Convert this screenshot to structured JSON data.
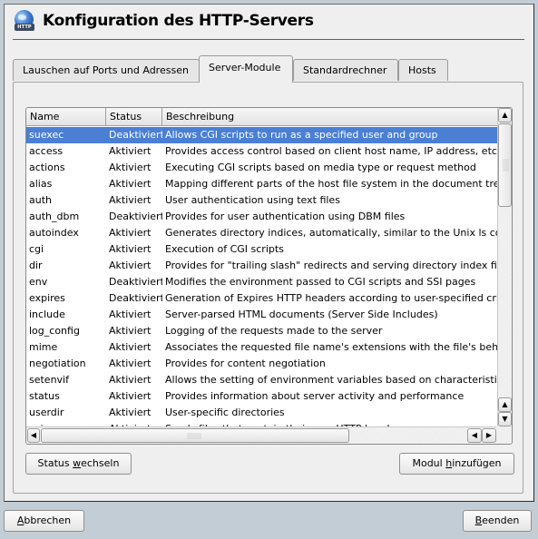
{
  "header": {
    "title": "Konfiguration des HTTP-Servers",
    "icon": "http-globe-icon",
    "icon_tag": "HTTP"
  },
  "tabs": [
    {
      "label": "Lauschen auf Ports und Adressen",
      "active": false
    },
    {
      "label": "Server-Module",
      "active": true
    },
    {
      "label": "Standardrechner",
      "active": false
    },
    {
      "label": "Hosts",
      "active": false
    }
  ],
  "table": {
    "columns": [
      "Name",
      "Status",
      "Beschreibung"
    ],
    "selected_index": 0,
    "rows": [
      {
        "name": "suexec",
        "status": "Deaktiviert",
        "description": "Allows CGI scripts to run as a specified user and group"
      },
      {
        "name": "access",
        "status": "Aktiviert",
        "description": "Provides access control based on client host name, IP address, etc."
      },
      {
        "name": "actions",
        "status": "Aktiviert",
        "description": "Executing CGI scripts based on media type or request method"
      },
      {
        "name": "alias",
        "status": "Aktiviert",
        "description": "Mapping different parts of the host file system in the document tree a"
      },
      {
        "name": "auth",
        "status": "Aktiviert",
        "description": "User authentication using text files"
      },
      {
        "name": "auth_dbm",
        "status": "Deaktiviert",
        "description": "Provides for user authentication using DBM files"
      },
      {
        "name": "autoindex",
        "status": "Aktiviert",
        "description": "Generates directory indices, automatically, similar to the Unix ls cor"
      },
      {
        "name": "cgi",
        "status": "Aktiviert",
        "description": "Execution of CGI scripts"
      },
      {
        "name": "dir",
        "status": "Aktiviert",
        "description": "Provides for \"trailing slash\" redirects and serving directory index files"
      },
      {
        "name": "env",
        "status": "Deaktiviert",
        "description": "Modifies the environment passed to CGI scripts and SSI pages"
      },
      {
        "name": "expires",
        "status": "Deaktiviert",
        "description": "Generation of Expires HTTP headers according to user-specified cri"
      },
      {
        "name": "include",
        "status": "Aktiviert",
        "description": "Server-parsed HTML documents (Server Side Includes)"
      },
      {
        "name": "log_config",
        "status": "Aktiviert",
        "description": "Logging of the requests made to the server"
      },
      {
        "name": "mime",
        "status": "Aktiviert",
        "description": "Associates the requested file name's extensions with the file's behav"
      },
      {
        "name": "negotiation",
        "status": "Aktiviert",
        "description": "Provides for content negotiation"
      },
      {
        "name": "setenvif",
        "status": "Aktiviert",
        "description": "Allows the setting of environment variables based on characteristics"
      },
      {
        "name": "status",
        "status": "Aktiviert",
        "description": "Provides information about server activity and performance"
      },
      {
        "name": "userdir",
        "status": "Aktiviert",
        "description": "User-specific directories"
      },
      {
        "name": "asis",
        "status": "Aktiviert",
        "description": "Sends files that contain their own HTTP headers"
      }
    ]
  },
  "scrollbars": {
    "up_arrow": "▲",
    "down_arrow": "▼",
    "left_arrow": "◀",
    "right_arrow": "▶"
  },
  "buttons": {
    "toggle_status": {
      "pre": "Status ",
      "accel": "w",
      "post": "echseln"
    },
    "add_module": {
      "pre": "Modul ",
      "accel": "h",
      "post": "inzufügen"
    },
    "cancel": {
      "pre": "",
      "accel": "A",
      "post": "bbrechen"
    },
    "finish": {
      "pre": "",
      "accel": "B",
      "post": "eenden"
    }
  },
  "colors": {
    "selection": "#4a7fd4",
    "desktop": "#c3cdd5"
  }
}
